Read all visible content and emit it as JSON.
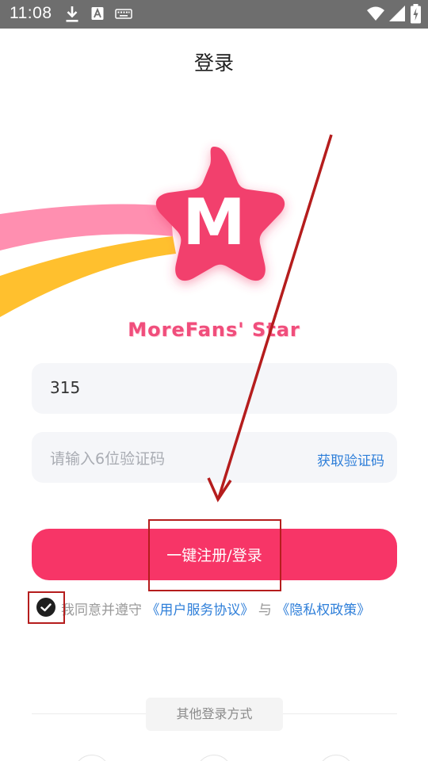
{
  "status_bar": {
    "time": "11:08",
    "icons": [
      "download-icon",
      "a-notification-icon",
      "keyboard-icon",
      "wifi-icon",
      "signal-icon",
      "battery-charging-icon"
    ]
  },
  "header": {
    "title": "登录"
  },
  "brand": {
    "name": "MoreFans' Star",
    "logo_letter": "M"
  },
  "form": {
    "phone_value": "315",
    "code_placeholder": "请输入6位验证码",
    "get_code_label": "获取验证码",
    "login_label": "一键注册/登录"
  },
  "agreement": {
    "prefix": "我同意并遵守",
    "terms_link": "《用户服务协议》",
    "conjunction": "与",
    "privacy_link": "《隐私权政策》",
    "checked": true
  },
  "other_login": {
    "label": "其他登录方式"
  },
  "colors": {
    "status_bar": "#6e6e6e",
    "primary": "#f73567",
    "link": "#2f7fd9",
    "field_bg": "#f5f6f9",
    "annotation": "#b51d1d",
    "logo_star": "#f2416d",
    "trail_pink": "#ff8fb0",
    "trail_yellow": "#ffc02e"
  }
}
